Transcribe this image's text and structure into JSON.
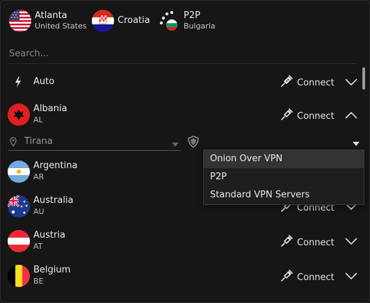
{
  "recents": [
    {
      "name": "Atlanta",
      "sub": "United States",
      "flag": "us-flag"
    },
    {
      "name": "Croatia",
      "sub": "",
      "flag": "croatia-flag"
    },
    {
      "name": "P2P",
      "sub": "Bulgaria",
      "flag": "p2p-icon"
    }
  ],
  "search": {
    "placeholder": "Search..."
  },
  "rows": [
    {
      "name": "Auto",
      "code": "",
      "connect": "Connect"
    },
    {
      "name": "Albania",
      "code": "AL",
      "connect": "Connect"
    },
    {
      "name": "Argentina",
      "code": "AR",
      "connect": "Connect"
    },
    {
      "name": "Australia",
      "code": "AU",
      "connect": "Connect"
    },
    {
      "name": "Austria",
      "code": "AT",
      "connect": "Connect"
    },
    {
      "name": "Belgium",
      "code": "BE",
      "connect": "Connect"
    }
  ],
  "expanded": {
    "city": "Tirana"
  },
  "dropdown": {
    "items": [
      "Onion Over VPN",
      "P2P",
      "Standard VPN Servers"
    ],
    "selected": "Onion Over VPN"
  },
  "colors": {
    "bg": "#161616",
    "text": "#e6e6e6",
    "muted": "#9c9c9c"
  }
}
